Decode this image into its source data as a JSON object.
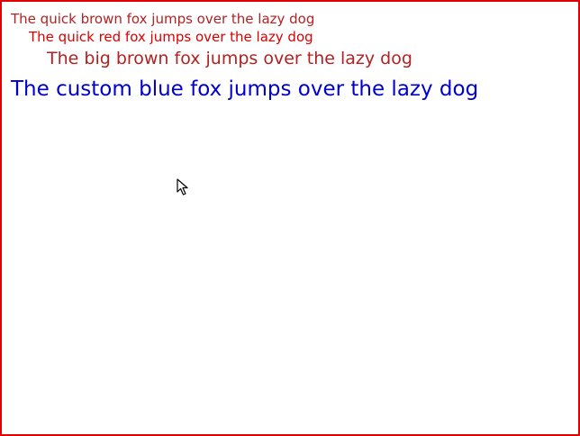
{
  "canvas": {
    "border_color": "#e00000",
    "background_color": "#ffffff"
  },
  "text_lines": [
    {
      "text": "The quick brown fox jumps over the lazy dog",
      "color": "#b22222"
    },
    {
      "text": "The quick red fox jumps over the lazy dog",
      "color": "#dd0000"
    },
    {
      "text": "The big brown fox jumps over the lazy dog",
      "color": "#b22222"
    },
    {
      "text": "The custom blue fox jumps over the lazy dog",
      "color": "#0000cc"
    }
  ],
  "cursor": {
    "icon": "mouse-pointer-icon"
  }
}
